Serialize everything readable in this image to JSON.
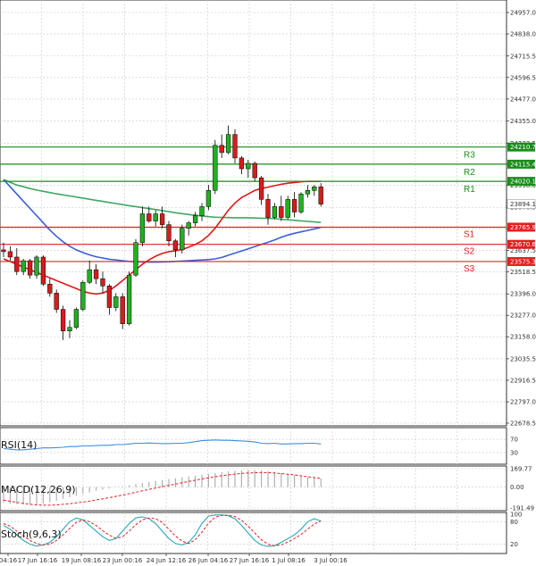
{
  "chart_data": {
    "type": "candlestick",
    "main": {
      "price_ticks": [
        "24957.0",
        "24838.0",
        "24715.5",
        "24596.5",
        "24477.0",
        "24355.0",
        "24232.5",
        "24115.4",
        "23998.0",
        "23876.5",
        "23757.5",
        "23637.5",
        "23518.5",
        "23396.0",
        "23277.0",
        "23158.0",
        "23035.5",
        "22916.5",
        "22797.0",
        "22678.5"
      ],
      "x_labels": [
        "04:16",
        "17 Jun 16:16",
        "19 Jun 08:16",
        "23 Jun 00:16",
        "24 Jun 12:16",
        "26 Jun 04:16",
        "27 Jun 16:16",
        "1 Jul 08:16",
        "3 Jul 00:16"
      ],
      "last_price": "23894.1",
      "levels": [
        {
          "name": "R3",
          "value": 24210.7,
          "label": "24210.7",
          "color": "#1a8c1a"
        },
        {
          "name": "R2",
          "value": 24115.4,
          "label": "24115.4",
          "color": "#1a8c1a"
        },
        {
          "name": "R1",
          "value": 24020.1,
          "label": "24020.1",
          "color": "#1a8c1a"
        },
        {
          "name": "S1",
          "value": 23765.9,
          "label": "23765.9",
          "color": "#e02020"
        },
        {
          "name": "S2",
          "value": 23670.6,
          "label": "23670.6",
          "color": "#e02020"
        },
        {
          "name": "S3",
          "value": 23575.3,
          "label": "23575.3",
          "color": "#e02020"
        }
      ],
      "candles": [
        {
          "o": 23640,
          "h": 23680,
          "l": 23600,
          "c": 23630
        },
        {
          "o": 23630,
          "h": 23660,
          "l": 23580,
          "c": 23600
        },
        {
          "o": 23600,
          "h": 23650,
          "l": 23500,
          "c": 23520
        },
        {
          "o": 23520,
          "h": 23590,
          "l": 23500,
          "c": 23580
        },
        {
          "o": 23580,
          "h": 23590,
          "l": 23480,
          "c": 23500
        },
        {
          "o": 23500,
          "h": 23610,
          "l": 23480,
          "c": 23600
        },
        {
          "o": 23600,
          "h": 23610,
          "l": 23440,
          "c": 23450
        },
        {
          "o": 23450,
          "h": 23480,
          "l": 23380,
          "c": 23400
        },
        {
          "o": 23400,
          "h": 23420,
          "l": 23290,
          "c": 23310
        },
        {
          "o": 23310,
          "h": 23330,
          "l": 23140,
          "c": 23190
        },
        {
          "o": 23190,
          "h": 23250,
          "l": 23150,
          "c": 23210
        },
        {
          "o": 23210,
          "h": 23320,
          "l": 23200,
          "c": 23310
        },
        {
          "o": 23310,
          "h": 23470,
          "l": 23300,
          "c": 23460
        },
        {
          "o": 23460,
          "h": 23580,
          "l": 23450,
          "c": 23530
        },
        {
          "o": 23530,
          "h": 23560,
          "l": 23450,
          "c": 23480
        },
        {
          "o": 23480,
          "h": 23520,
          "l": 23400,
          "c": 23440
        },
        {
          "o": 23440,
          "h": 23450,
          "l": 23280,
          "c": 23320
        },
        {
          "o": 23320,
          "h": 23400,
          "l": 23300,
          "c": 23380
        },
        {
          "o": 23380,
          "h": 23400,
          "l": 23200,
          "c": 23230
        },
        {
          "o": 23230,
          "h": 23520,
          "l": 23220,
          "c": 23500
        },
        {
          "o": 23500,
          "h": 23700,
          "l": 23490,
          "c": 23680
        },
        {
          "o": 23680,
          "h": 23880,
          "l": 23660,
          "c": 23840
        },
        {
          "o": 23840,
          "h": 23880,
          "l": 23790,
          "c": 23800
        },
        {
          "o": 23800,
          "h": 23860,
          "l": 23770,
          "c": 23840
        },
        {
          "o": 23840,
          "h": 23880,
          "l": 23760,
          "c": 23780
        },
        {
          "o": 23780,
          "h": 23800,
          "l": 23660,
          "c": 23690
        },
        {
          "o": 23690,
          "h": 23700,
          "l": 23600,
          "c": 23640
        },
        {
          "o": 23640,
          "h": 23780,
          "l": 23620,
          "c": 23760
        },
        {
          "o": 23760,
          "h": 23800,
          "l": 23720,
          "c": 23790
        },
        {
          "o": 23790,
          "h": 23850,
          "l": 23770,
          "c": 23830
        },
        {
          "o": 23830,
          "h": 23900,
          "l": 23800,
          "c": 23880
        },
        {
          "o": 23880,
          "h": 24000,
          "l": 23860,
          "c": 23970
        },
        {
          "o": 23970,
          "h": 24250,
          "l": 23950,
          "c": 24220
        },
        {
          "o": 24220,
          "h": 24280,
          "l": 24150,
          "c": 24180
        },
        {
          "o": 24180,
          "h": 24330,
          "l": 24170,
          "c": 24280
        },
        {
          "o": 24280,
          "h": 24310,
          "l": 24120,
          "c": 24150
        },
        {
          "o": 24150,
          "h": 24160,
          "l": 24060,
          "c": 24090
        },
        {
          "o": 24090,
          "h": 24140,
          "l": 24040,
          "c": 24120
        },
        {
          "o": 24120,
          "h": 24130,
          "l": 24020,
          "c": 24040
        },
        {
          "o": 24040,
          "h": 24050,
          "l": 23890,
          "c": 23920
        },
        {
          "o": 23920,
          "h": 23950,
          "l": 23780,
          "c": 23820
        },
        {
          "o": 23820,
          "h": 23900,
          "l": 23810,
          "c": 23880
        },
        {
          "o": 23880,
          "h": 23940,
          "l": 23800,
          "c": 23820
        },
        {
          "o": 23820,
          "h": 23940,
          "l": 23810,
          "c": 23920
        },
        {
          "o": 23920,
          "h": 23960,
          "l": 23820,
          "c": 23850
        },
        {
          "o": 23850,
          "h": 23960,
          "l": 23840,
          "c": 23950
        },
        {
          "o": 23950,
          "h": 24000,
          "l": 23930,
          "c": 23970
        },
        {
          "o": 23970,
          "h": 24000,
          "l": 23940,
          "c": 23990
        },
        {
          "o": 23990,
          "h": 24010,
          "l": 23880,
          "c": 23894
        }
      ],
      "ma_red": [
        23590,
        23575,
        23560,
        23545,
        23530,
        23515,
        23500,
        23485,
        23470,
        23455,
        23440,
        23425,
        23410,
        23400,
        23395,
        23400,
        23415,
        23440,
        23470,
        23500,
        23530,
        23560,
        23585,
        23605,
        23620,
        23630,
        23635,
        23642,
        23655,
        23670,
        23690,
        23720,
        23760,
        23810,
        23860,
        23900,
        23930,
        23950,
        23970,
        23980,
        23988,
        23996,
        24004,
        24010,
        24014,
        24018,
        24020,
        24020,
        24020
      ],
      "ma_green": [
        24030,
        24015,
        24000,
        23990,
        23980,
        23972,
        23965,
        23958,
        23951,
        23945,
        23939,
        23933,
        23927,
        23921,
        23915,
        23909,
        23903,
        23897,
        23891,
        23885,
        23880,
        23874,
        23869,
        23864,
        23858,
        23852,
        23846,
        23841,
        23836,
        23832,
        23828,
        23824,
        23821,
        23820,
        23819,
        23818,
        23818,
        23818,
        23817,
        23816,
        23815,
        23813,
        23810,
        23807,
        23804,
        23801,
        23798,
        23795,
        23792
      ],
      "ma_blue": [
        24030,
        23990,
        23950,
        23910,
        23870,
        23830,
        23790,
        23750,
        23715,
        23685,
        23660,
        23640,
        23625,
        23612,
        23602,
        23595,
        23588,
        23584,
        23580,
        23576,
        23574,
        23573,
        23572,
        23572,
        23573,
        23574,
        23576,
        23578,
        23580,
        23582,
        23584,
        23586,
        23590,
        23598,
        23610,
        23622,
        23634,
        23646,
        23658,
        23670,
        23682,
        23695,
        23710,
        23722,
        23732,
        23740,
        23748,
        23756,
        23765
      ]
    },
    "rsi": {
      "name": "RSI(14)",
      "ticks": [
        "70",
        "30"
      ],
      "ylim": [
        0,
        100
      ],
      "values": [
        42,
        40,
        38,
        38,
        40,
        42,
        44,
        44,
        45,
        46,
        48,
        48,
        50,
        50,
        51,
        52,
        52,
        54,
        54,
        56,
        58,
        58,
        59,
        58,
        57,
        57,
        58,
        58,
        60,
        63,
        66,
        67,
        68,
        67,
        67,
        66,
        65,
        64,
        62,
        58,
        57,
        58,
        56,
        56,
        57,
        57,
        58,
        58,
        56
      ]
    },
    "macd": {
      "name": "MACD(12,26,9)",
      "ticks": [
        "169.77",
        "0.00",
        "-191.49"
      ],
      "ylim": [
        -191.49,
        169.77
      ],
      "hist": [
        -140,
        -150,
        -158,
        -160,
        -162,
        -158,
        -150,
        -140,
        -125,
        -108,
        -92,
        -78,
        -62,
        -48,
        -34,
        -22,
        -12,
        -2,
        8,
        18,
        28,
        38,
        48,
        57,
        66,
        74,
        82,
        90,
        98,
        106,
        114,
        122,
        130,
        138,
        145,
        150,
        154,
        156,
        156,
        153,
        148,
        140,
        130,
        120,
        110,
        100,
        92,
        86,
        80
      ],
      "signal": [
        -120,
        -130,
        -140,
        -150,
        -158,
        -163,
        -166,
        -166,
        -163,
        -158,
        -152,
        -145,
        -137,
        -128,
        -118,
        -108,
        -97,
        -85,
        -73,
        -60,
        -47,
        -34,
        -21,
        -8,
        4,
        16,
        28,
        40,
        52,
        64,
        75,
        86,
        96,
        105,
        113,
        120,
        126,
        130,
        133,
        134,
        133,
        130,
        125,
        119,
        112,
        104,
        96,
        88,
        80
      ]
    },
    "stoch": {
      "name": "Stoch(9,6,3)",
      "ticks": [
        "100",
        "80",
        "20"
      ],
      "ylim": [
        0,
        100
      ],
      "k": [
        70,
        60,
        45,
        30,
        20,
        15,
        18,
        25,
        40,
        60,
        80,
        90,
        85,
        70,
        55,
        40,
        30,
        35,
        55,
        75,
        90,
        93,
        88,
        75,
        55,
        35,
        22,
        18,
        25,
        45,
        75,
        95,
        98,
        98,
        96,
        88,
        70,
        50,
        30,
        18,
        14,
        16,
        25,
        35,
        45,
        60,
        80,
        88,
        82
      ],
      "d": [
        75,
        68,
        55,
        42,
        30,
        22,
        18,
        20,
        30,
        45,
        62,
        78,
        85,
        80,
        70,
        56,
        44,
        36,
        40,
        55,
        72,
        85,
        90,
        88,
        78,
        60,
        42,
        28,
        22,
        32,
        52,
        76,
        92,
        97,
        97,
        94,
        84,
        68,
        50,
        32,
        20,
        16,
        18,
        26,
        35,
        46,
        60,
        74,
        82
      ]
    }
  }
}
